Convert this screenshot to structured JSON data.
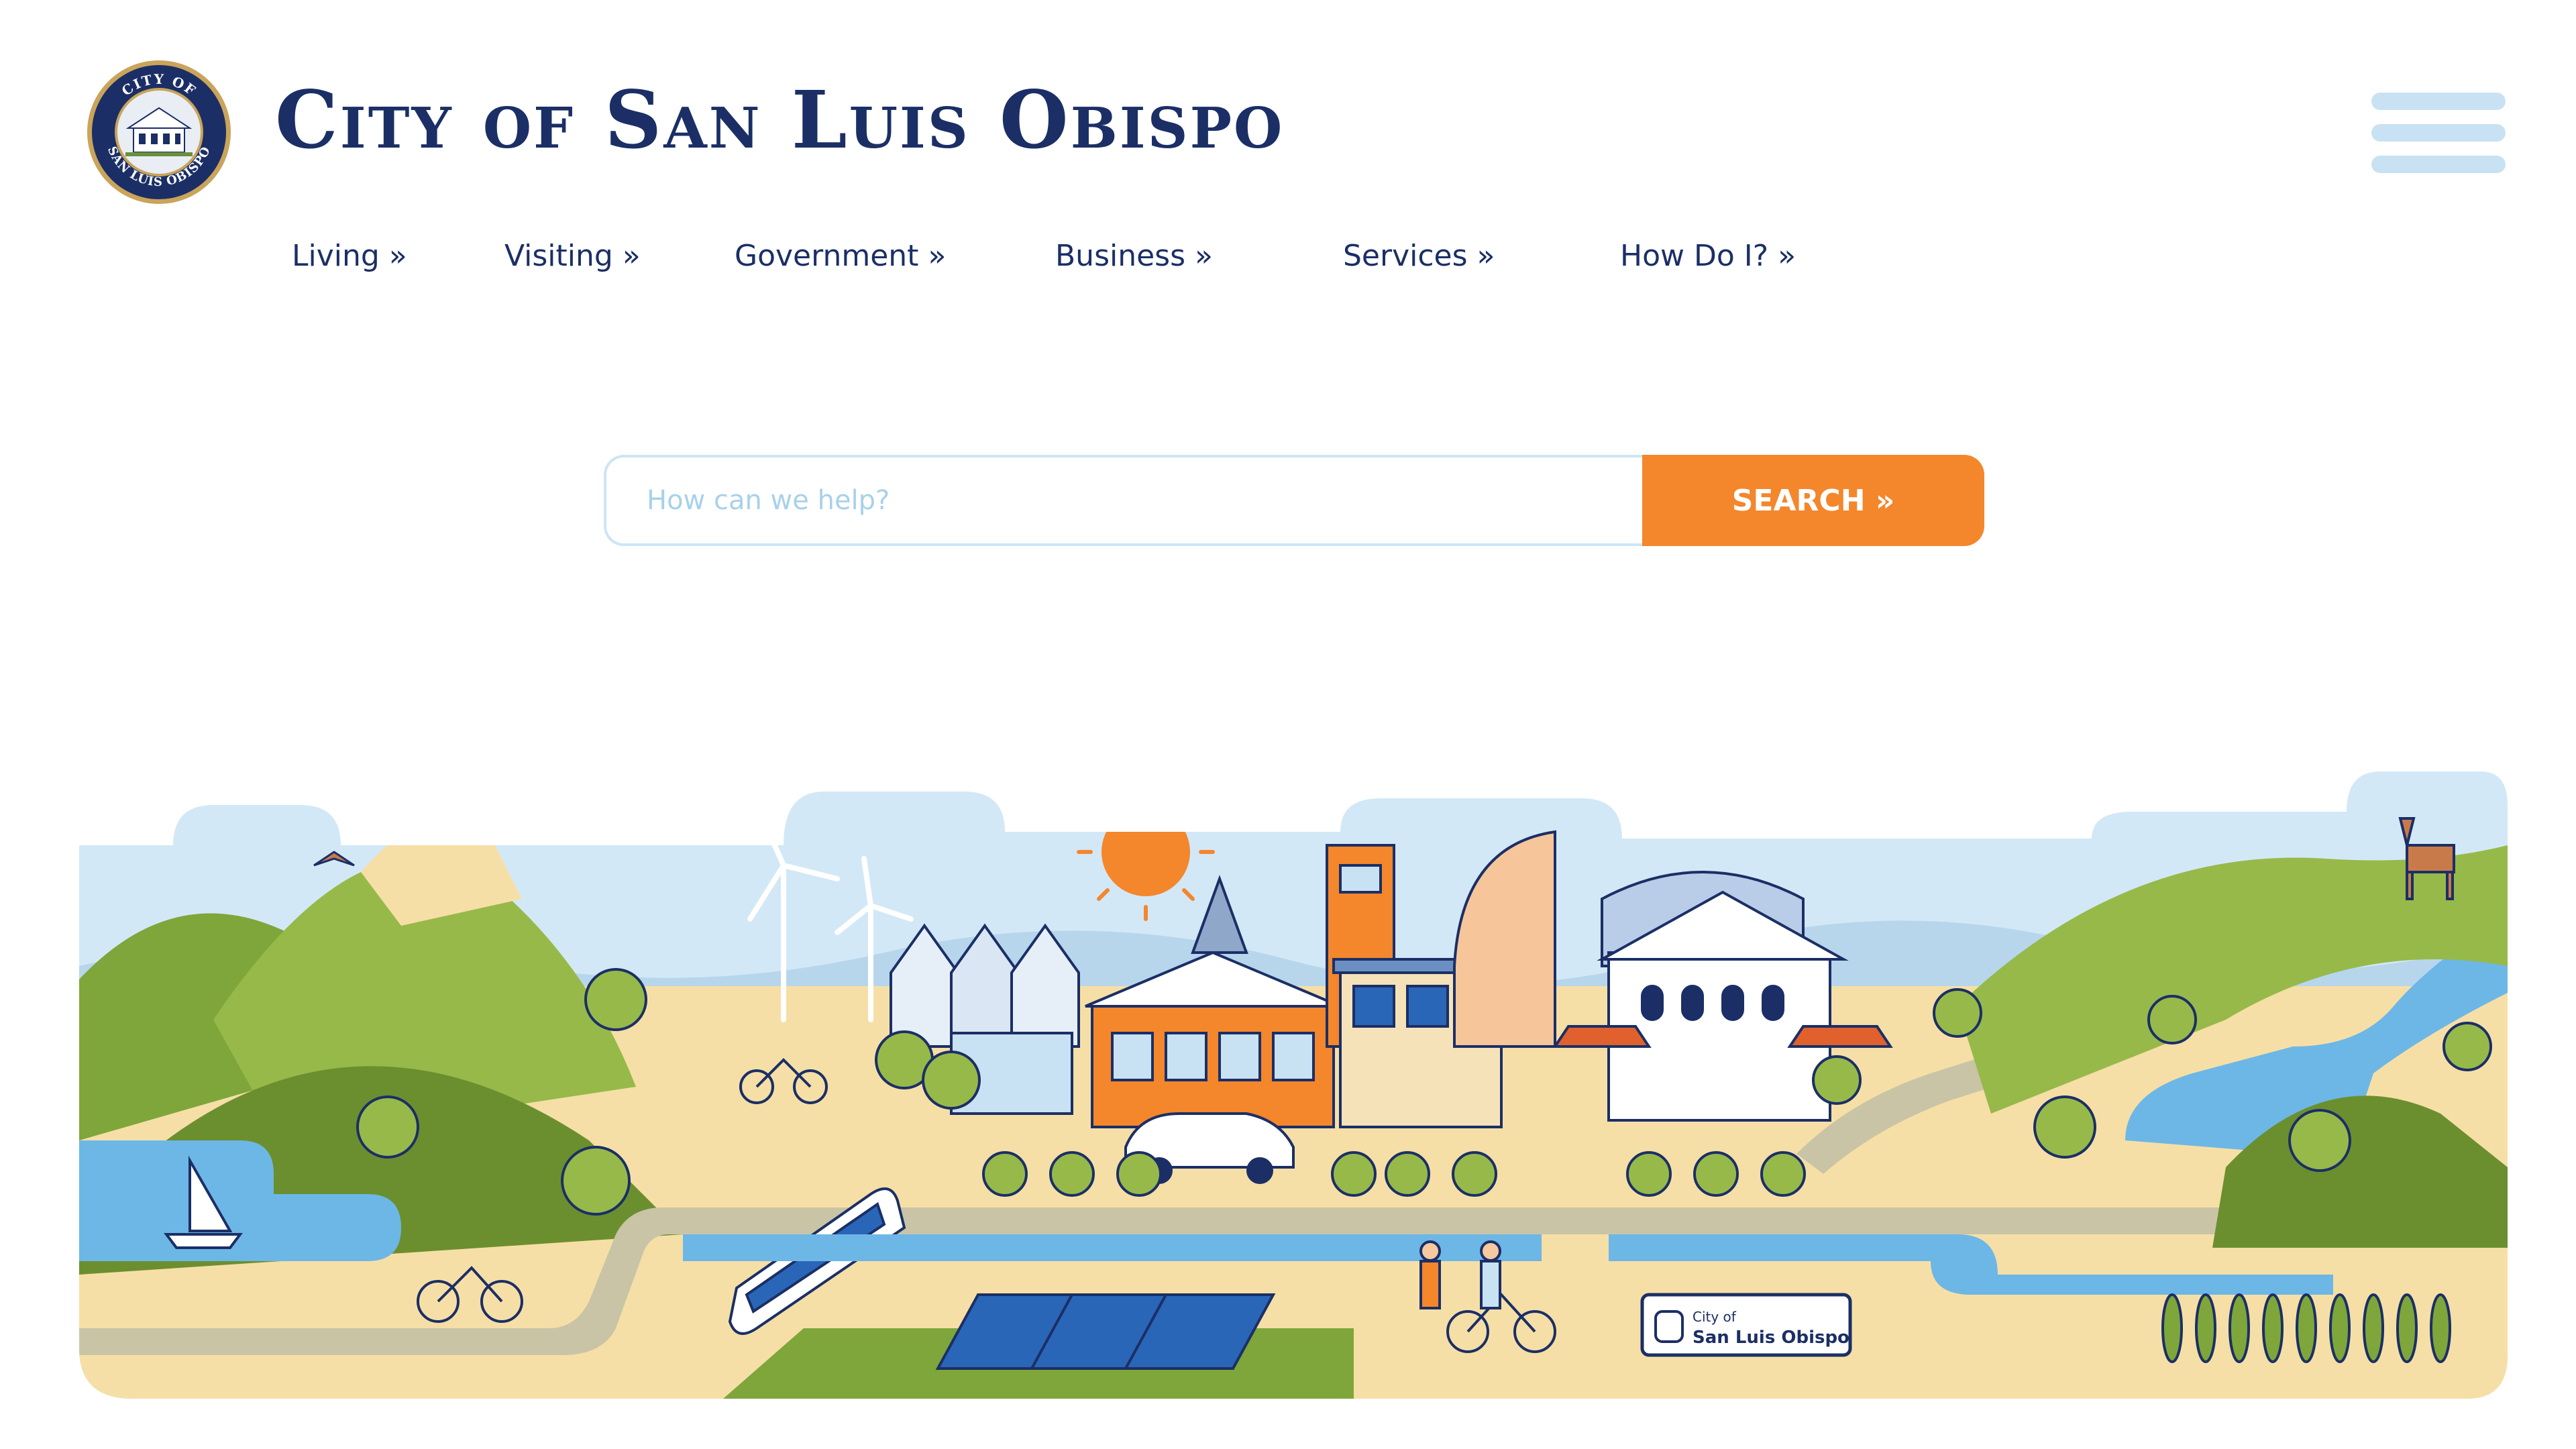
{
  "header": {
    "site_title": "City of San Luis Obispo",
    "seal": {
      "text_top": "CITY OF",
      "text_bottom": "SAN LUIS OBISPO"
    },
    "menu_icon": "hamburger-menu-icon"
  },
  "nav": {
    "items": [
      {
        "label": "Living »"
      },
      {
        "label": "Visiting »"
      },
      {
        "label": "Government »"
      },
      {
        "label": "Business »"
      },
      {
        "label": "Services »"
      },
      {
        "label": "How Do I? »"
      }
    ]
  },
  "search": {
    "placeholder": "How can we help?",
    "value": "",
    "button_label": "SEARCH »"
  },
  "illustration": {
    "sign_line1": "City of",
    "sign_line2": "San Luis Obispo"
  },
  "colors": {
    "navy": "#1b2f66",
    "orange": "#f4862c",
    "light_blue": "#c9e2f3",
    "green": "#7ea63a",
    "sand": "#f6dfa6"
  }
}
